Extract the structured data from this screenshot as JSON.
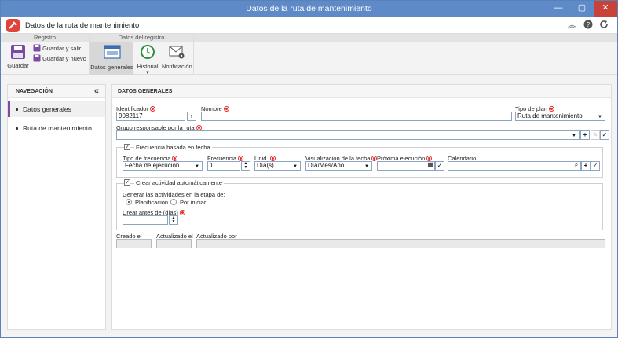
{
  "window": {
    "title": "Datos de la ruta de mantenimiento"
  },
  "header": {
    "title": "Datos de la ruta de mantenimiento"
  },
  "ribbon": {
    "group_registro": "Registro",
    "group_datos": "Datos del registro",
    "guardar": "Guardar",
    "guardar_salir": "Guardar y salir",
    "guardar_nuevo": "Guardar y nuevo",
    "datos_generales": "Datos generales",
    "historial": "Historial",
    "notificacion": "Notificación"
  },
  "nav": {
    "title": "NAVEGACIÓN",
    "items": [
      "Datos generales",
      "Ruta de mantenimiento"
    ]
  },
  "main": {
    "title": "DATOS GENERALES",
    "identificador_label": "Identificador",
    "identificador_value": "9082117",
    "nombre_label": "Nombre",
    "nombre_value": "",
    "tipo_plan_label": "Tipo de plan",
    "tipo_plan_value": "Ruta de mantenimiento",
    "grupo_label": "Grupo responsable por la ruta",
    "grupo_value": "",
    "frecuencia_section": "Frecuencia basada en fecha",
    "tipo_frecuencia_label": "Tipo de frecuencia",
    "tipo_frecuencia_value": "Fecha de ejecución",
    "frecuencia_label": "Frecuencia",
    "frecuencia_value": "1",
    "unid_label": "Unid.",
    "unid_value": "Día(s)",
    "visualizacion_label": "Visualización de la fecha",
    "visualizacion_value": "Día/Mes/Año",
    "proxima_label": "Próxima ejecución",
    "proxima_value": "",
    "calendario_label": "Calendario",
    "calendario_value": "",
    "actividad_section": "Crear actividad automáticamente",
    "generar_label": "Generar las actividades en la etapa de:",
    "radio_planificacion": "Planificación",
    "radio_por_iniciar": "Por iniciar",
    "crear_antes_label": "Crear antes de (días)",
    "crear_antes_value": "",
    "creado_label": "Creado el",
    "actualizado_label": "Actualizado el",
    "actualizado_por_label": "Actualizado por"
  },
  "colors": {
    "titlebar": "#5e8ac7",
    "logo": "#e2443b",
    "nav_active": "#7b4aa3",
    "required": "#e03030"
  }
}
